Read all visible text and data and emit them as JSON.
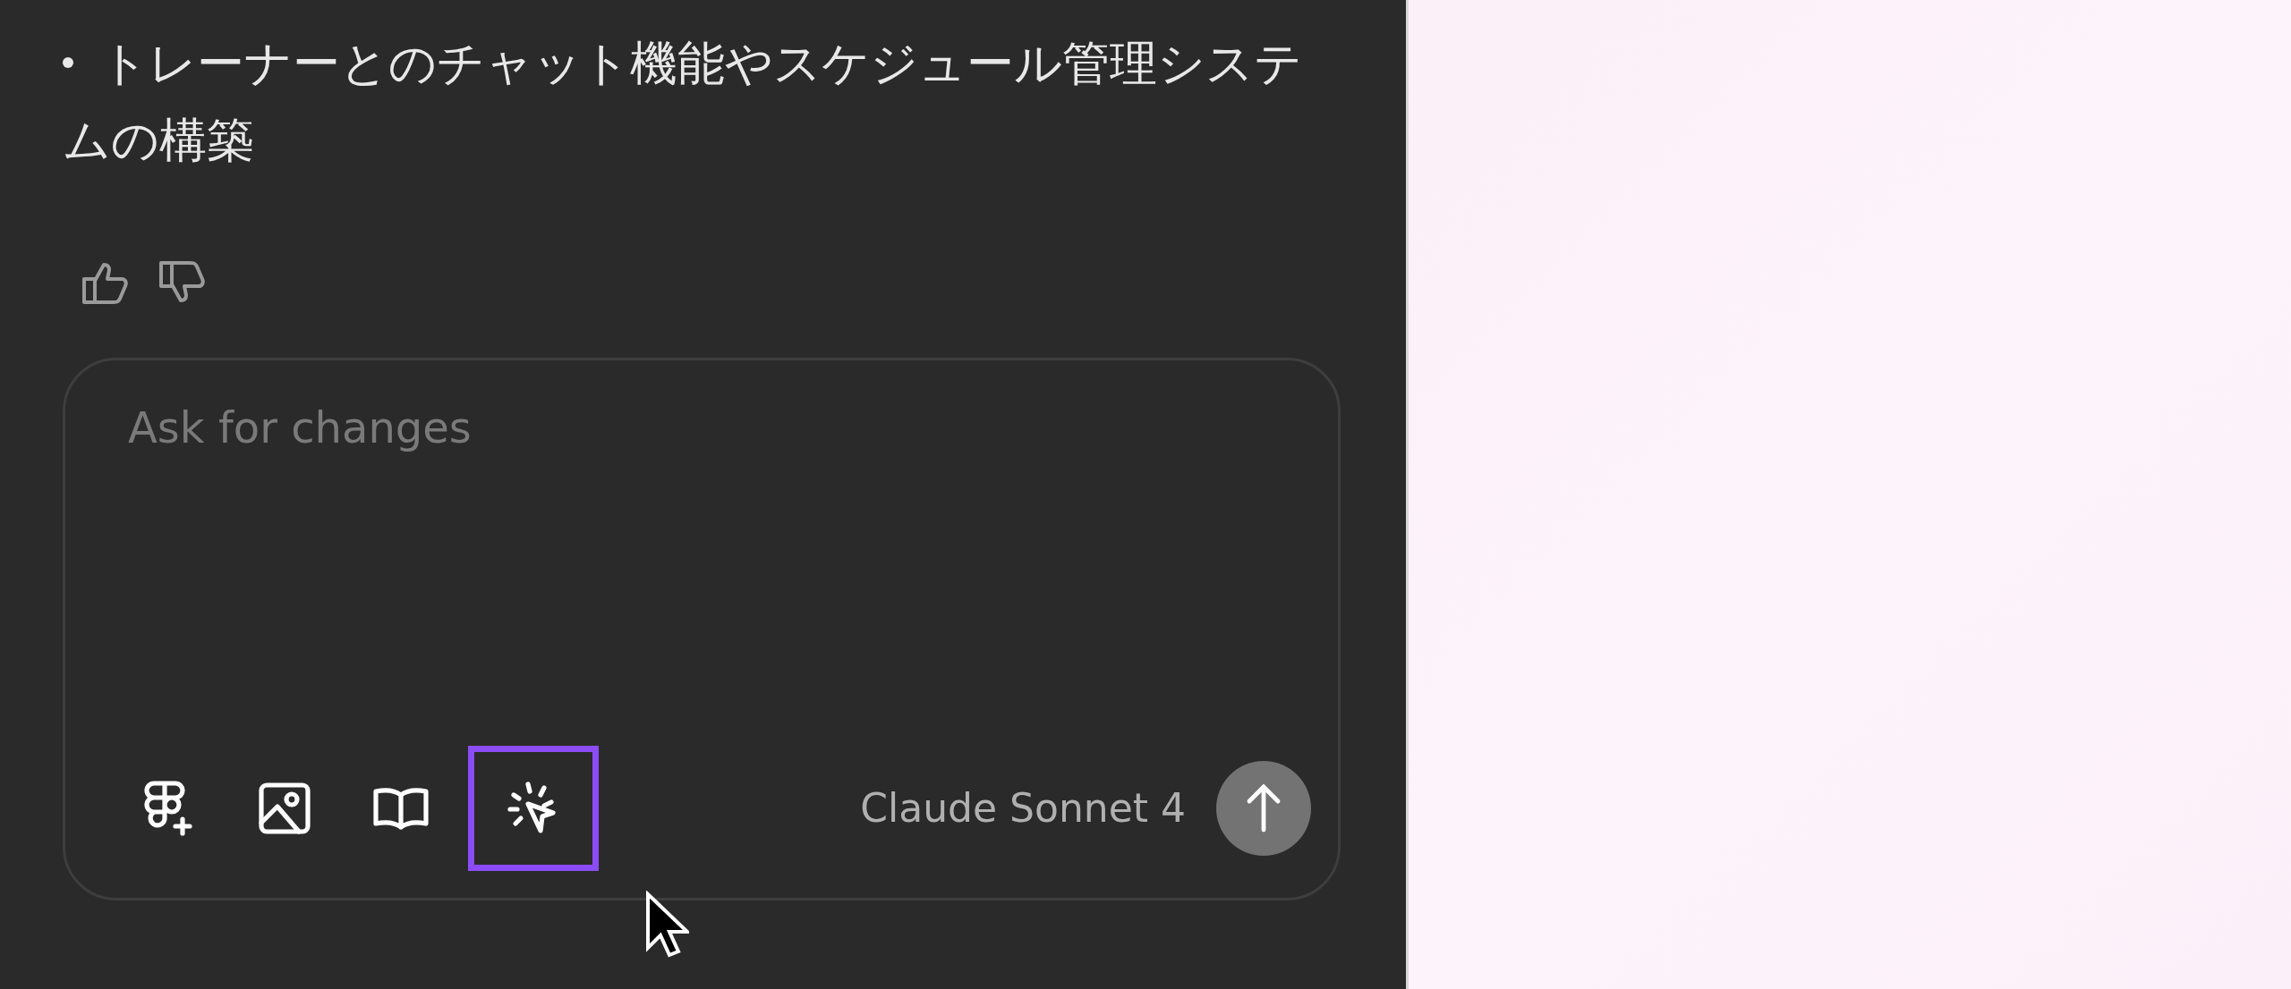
{
  "message": {
    "bullets": [
      "トレーナーとのチャット機能やスケジュール管理システムの構築"
    ]
  },
  "composer": {
    "placeholder": "Ask for changes",
    "model": "Claude Sonnet 4",
    "tools": [
      {
        "kind": "figma",
        "selected": false
      },
      {
        "kind": "image",
        "selected": false
      },
      {
        "kind": "book",
        "selected": false
      },
      {
        "kind": "select",
        "selected": true
      }
    ]
  }
}
